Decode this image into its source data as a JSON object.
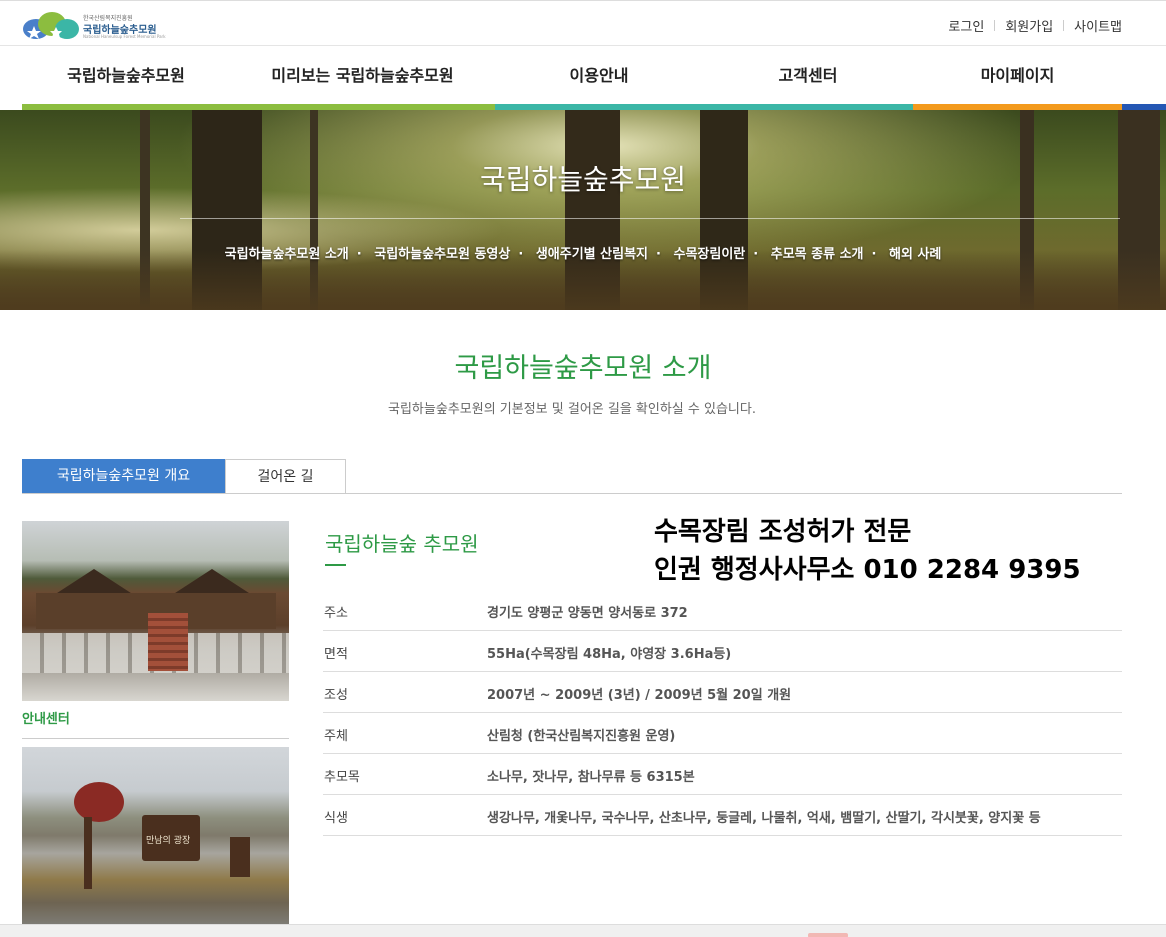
{
  "logo": {
    "small": "한국산림복지진흥원",
    "name": "국립하늘숲추모원",
    "eng": "National Haneulsup Forest Memorial Park"
  },
  "util_links": [
    "로그인",
    "회원가입",
    "사이트맵"
  ],
  "gnb": [
    "국립하늘숲추모원",
    "미리보는 국립하늘숲추모원",
    "이용안내",
    "고객센터",
    "마이페이지"
  ],
  "gnb_colors": {
    "green": "#8cbd3f",
    "teal": "#3bb6a6",
    "orange": "#f39a1d",
    "blue": "#2557b4"
  },
  "hero": {
    "title": "국립하늘숲추모원",
    "subnav": [
      "국립하늘숲추모원 소개",
      "국립하늘숲추모원 동영상",
      "생애주기별 산림복지",
      "수목장림이란",
      "추모목 종류 소개",
      "해외 사례"
    ]
  },
  "page": {
    "title": "국립하늘숲추모원 소개",
    "desc": "국립하늘숲추모원의 기본정보 및 걸어온 길을 확인하실 수 있습니다."
  },
  "tabs": {
    "active": "국립하늘숲추모원 개요",
    "inactive": "걸어온 길"
  },
  "photos": {
    "caption1": "안내센터",
    "sign_text": "만남의 광장"
  },
  "info": {
    "title": "국립하늘숲 추모원",
    "rows": [
      {
        "label": "주소",
        "value": "경기도 양평군 양동면 양서동로 372"
      },
      {
        "label": "면적",
        "value": "55Ha(수목장림 48Ha, 야영장 3.6Ha등)"
      },
      {
        "label": "조성",
        "value": "2007년 ~ 2009년 (3년) / 2009년 5월 20일 개원"
      },
      {
        "label": "주체",
        "value": "산림청 (한국산림복지진흥원 운영)"
      },
      {
        "label": "추모목",
        "value": "소나무, 잣나무, 참나무류 등 6315본"
      },
      {
        "label": "식생",
        "value": "생강나무, 개옻나무, 국수나무, 산초나무, 둥글레, 나물취, 억새, 뱀딸기, 산딸기, 각시붓꽃, 양지꽃 등"
      }
    ]
  },
  "promo": {
    "line1": "수목장림 조성허가 전문",
    "line2": "인권 행정사사무소 010 2284 9395"
  }
}
